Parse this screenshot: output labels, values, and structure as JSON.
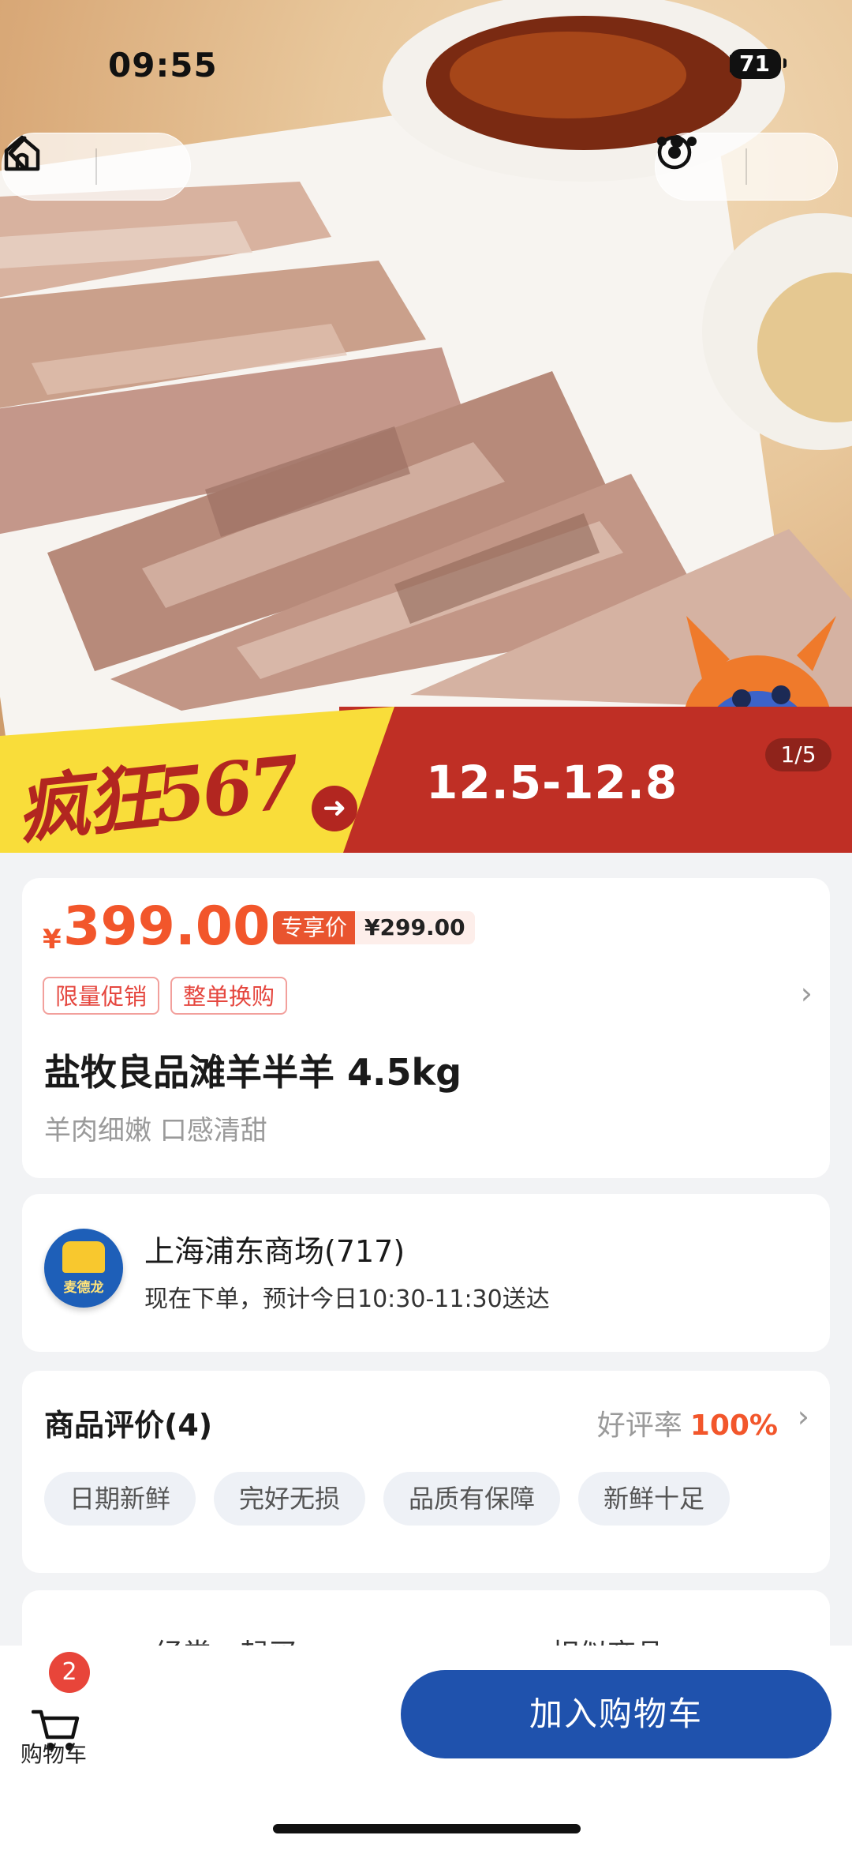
{
  "status_bar": {
    "time": "09:55",
    "battery": "71"
  },
  "promo": {
    "slogan": "疯狂567",
    "date_range": "12.5-12.8",
    "pager": "1/5"
  },
  "product": {
    "price_symbol": "¥",
    "price": "399.00",
    "vip_tag": "专享价",
    "vip_price": "¥299.00",
    "tags": [
      "限量促销",
      "整单换购"
    ],
    "title": "盐牧良品滩羊半羊 4.5kg",
    "subtitle": "羊肉细嫩 口感清甜"
  },
  "store": {
    "brand": "麦德龙",
    "name": "上海浦东商场(717)",
    "eta": "现在下单，预计今日10:30-11:30送达"
  },
  "reviews": {
    "title": "商品评价(4)",
    "rate_label": "好评率",
    "rate_value": "100%",
    "chips": [
      "日期新鲜",
      "完好无损",
      "品质有保障",
      "新鲜十足"
    ]
  },
  "tabs": [
    "经常一起买",
    "相似商品"
  ],
  "bottom_bar": {
    "cart_label": "购物车",
    "cart_count": "2",
    "add_to_cart": "加入购物车"
  },
  "colors": {
    "accent": "#f2562b",
    "primary": "#1f52ad",
    "banner_red": "#bf2f25",
    "banner_yellow": "#f9dd3a"
  },
  "icons": [
    "back-icon",
    "home-icon",
    "more-icon",
    "target-icon",
    "cart-icon",
    "chevron-right-icon",
    "signal-icon",
    "wifi-icon"
  ]
}
